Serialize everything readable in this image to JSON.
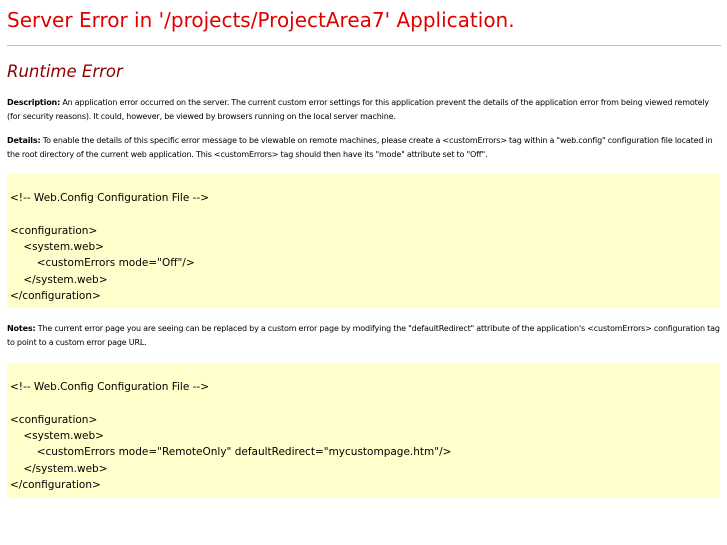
{
  "header": {
    "title": "Server Error in '/projects/ProjectArea7' Application."
  },
  "error": {
    "heading": "Runtime Error"
  },
  "description": {
    "label": "Description:",
    "text": " An application error occurred on the server. The current custom error settings for this application prevent the details of the application error from being viewed remotely (for security reasons). It could, however, be viewed by browsers running on the local server machine."
  },
  "details": {
    "label": "Details:",
    "text": " To enable the details of this specific error message to be viewable on remote machines, please create a <customErrors> tag within a \"web.config\" configuration file located in the root directory of the current web application. This <customErrors> tag should then have its \"mode\" attribute set to \"Off\"."
  },
  "code_sample_1": {
    "lines": [
      "",
      "<!-- Web.Config Configuration File -->",
      "",
      "<configuration>",
      "    <system.web>",
      "        <customErrors mode=\"Off\"/>",
      "    </system.web>",
      "</configuration>"
    ]
  },
  "notes": {
    "label": "Notes:",
    "text": " The current error page you are seeing can be replaced by a custom error page by modifying the \"defaultRedirect\" attribute of the application's <customErrors> configuration tag to point to a custom error page URL."
  },
  "code_sample_2": {
    "lines": [
      "",
      "<!-- Web.Config Configuration File -->",
      "",
      "<configuration>",
      "    <system.web>",
      "        <customErrors mode=\"RemoteOnly\" defaultRedirect=\"mycustompage.htm\"/>",
      "    </system.web>",
      "</configuration>"
    ]
  }
}
